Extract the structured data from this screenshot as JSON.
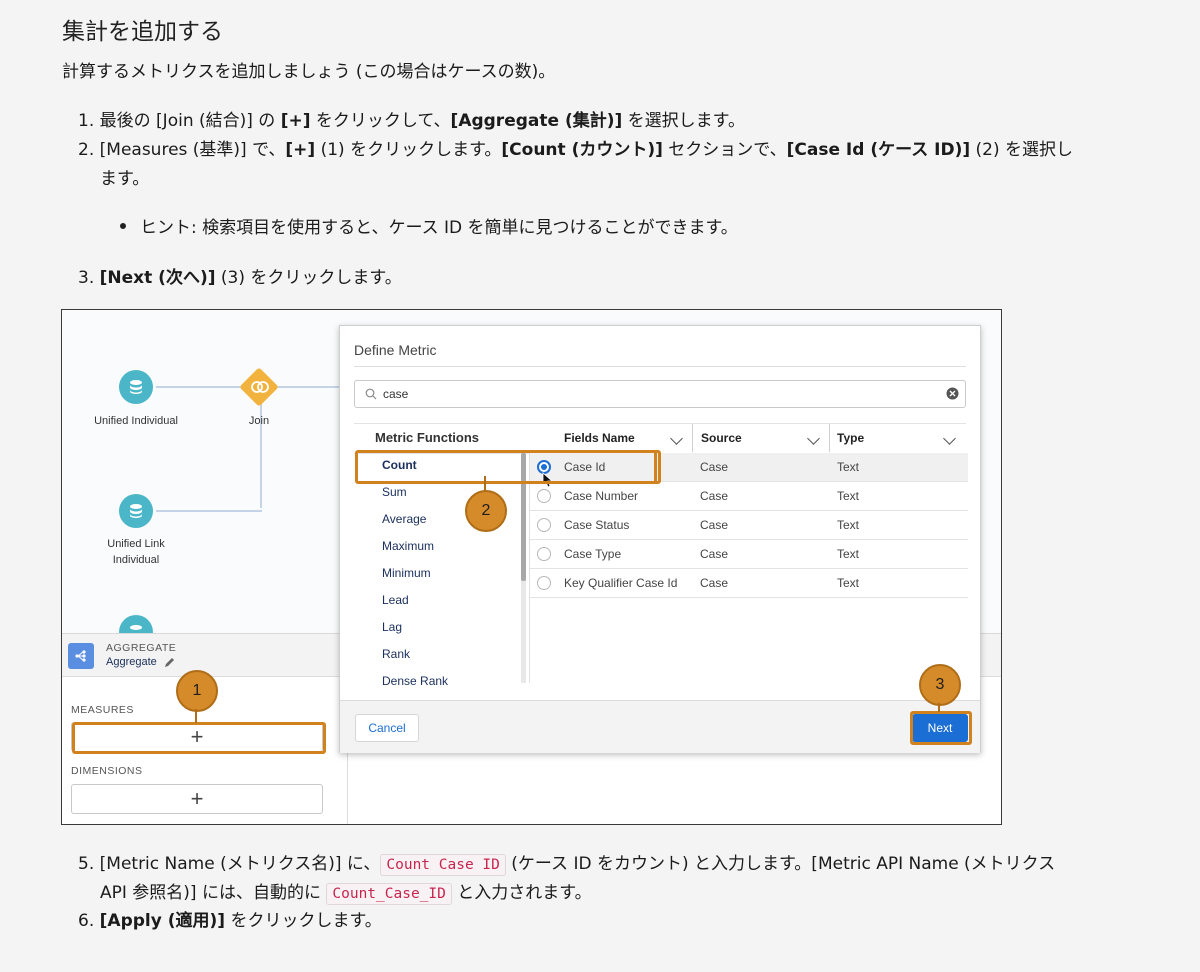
{
  "heading": "集計を追加する",
  "intro": "計算するメトリクスを追加しましょう (この場合はケースの数)。",
  "steps": {
    "s1": {
      "num": "1.",
      "a": "最後の [Join (結合)] の ",
      "b1": "[+]",
      "c": " をクリックして、",
      "b2": "[Aggregate (集計)]",
      "d": " を選択します。"
    },
    "s2": {
      "num": "2.",
      "a": "[Measures (基準)] で、",
      "b1": "[+]",
      "c": " (1) をクリックします。",
      "b2": "[Count (カウント)]",
      "d": " セクションで、",
      "b3": "[Case Id (ケース ID)]",
      "e": " (2) を選択し",
      "wrap": "ます。"
    },
    "hint": "ヒント: 検索項目を使用すると、ケース ID を簡単に見つけることができます。",
    "s3": {
      "num": "3.",
      "b1": "[Next (次へ)]",
      "a": " (3) をクリックします。"
    },
    "s5": {
      "num": "5.",
      "a": "[Metric Name (メトリクス名)] に、",
      "code1": "Count Case ID",
      "b": " (ケース ID をカウント) と入力します。[Metric API Name (メトリクス",
      "wrap_a": "API 参照名)] には、自動的に ",
      "code2": "Count_Case_ID",
      "wrap_b": " と入力されます。"
    },
    "s6": {
      "num": "6.",
      "b1": "[Apply (適用)]",
      "a": " をクリックします。"
    }
  },
  "screenshot": {
    "nodes": {
      "unified_individual": "Unified Individual",
      "join": "Join",
      "unified_link_1": "Unified Link",
      "unified_link_2": "Individual"
    },
    "aggregate": {
      "type": "AGGREGATE",
      "name": "Aggregate",
      "measures": "MEASURES",
      "dimensions": "DIMENSIONS",
      "plus": "+"
    },
    "modal": {
      "title": "Define Metric",
      "search_value": "case",
      "headers": {
        "functions": "Metric Functions",
        "fields": "Fields Name",
        "source": "Source",
        "type": "Type"
      },
      "functions": [
        "Count",
        "Sum",
        "Average",
        "Maximum",
        "Minimum",
        "Lead",
        "Lag",
        "Rank",
        "Dense Rank"
      ],
      "rows": [
        {
          "field": "Case Id",
          "source": "Case",
          "type": "Text"
        },
        {
          "field": "Case Number",
          "source": "Case",
          "type": "Text"
        },
        {
          "field": "Case Status",
          "source": "Case",
          "type": "Text"
        },
        {
          "field": "Case Type",
          "source": "Case",
          "type": "Text"
        },
        {
          "field": "Key Qualifier Case Id",
          "source": "Case",
          "type": "Text"
        }
      ],
      "cancel": "Cancel",
      "next": "Next"
    },
    "badges": {
      "b1": "1",
      "b2": "2",
      "b3": "3"
    },
    "colors": {
      "accent": "#1b6ed3",
      "callout": "#d2821c",
      "node": "#4bb6c8",
      "join": "#f2b23e"
    }
  }
}
